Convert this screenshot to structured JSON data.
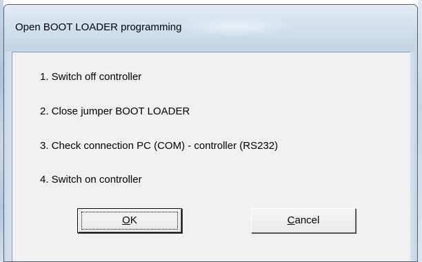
{
  "dialog": {
    "title": "Open BOOT LOADER programming",
    "steps": [
      "1. Switch off controller",
      "2. Close jumper BOOT LOADER",
      "3. Check connection PC (COM) - controller (RS232)",
      "4. Switch on controller"
    ],
    "buttons": {
      "ok": {
        "mnemonic": "O",
        "rest": "K"
      },
      "cancel": {
        "mnemonic": "C",
        "rest": "ancel"
      }
    }
  }
}
